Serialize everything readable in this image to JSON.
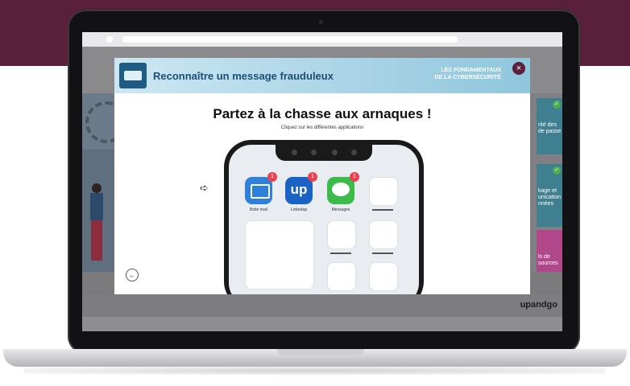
{
  "modal": {
    "title": "Reconnaître un message frauduleux",
    "brand_line1": "LES FONDAMENTAUX",
    "brand_line2": "DE LA CYBERSÉCURITÉ",
    "close_glyph": "×",
    "heading": "Partez à la chasse aux arnaques !",
    "instruction": "Cliquez sur les différentes applications",
    "hint_arrow": "➪",
    "back_glyph": "←"
  },
  "apps": [
    {
      "name": "Boite mail",
      "badge": "1",
      "color": "#2f80d8"
    },
    {
      "name": "Linkedup",
      "badge": "1",
      "color": "#1a63c4",
      "icon_text": "up"
    },
    {
      "name": "Messages",
      "badge": "1",
      "color": "#3dbb4a"
    }
  ],
  "background": {
    "right_tiles": [
      {
        "text": "rité des de passe"
      },
      {
        "text": "kage et unication nnées"
      },
      {
        "text": "ls de sources"
      }
    ],
    "check_glyph": "✓",
    "brand_footer": "upandgo"
  },
  "colors": {
    "brand_plum": "#5a1f3a",
    "header_blue": "#1c4e76",
    "badge_red": "#e8434f"
  }
}
